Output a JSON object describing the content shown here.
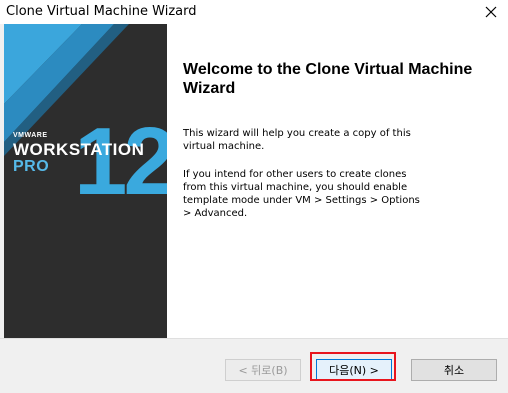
{
  "window": {
    "title": "Clone Virtual Machine Wizard"
  },
  "banner": {
    "vendor": "VMWARE",
    "product": "WORKSTATION",
    "edition": "PRO",
    "version": "12",
    "colors": {
      "background": "#2d2d2d",
      "accent": "#56b9e8"
    }
  },
  "content": {
    "heading": "Welcome to the Clone Virtual Machine Wizard",
    "paragraph1": "This wizard will help you create a copy of this virtual machine.",
    "paragraph2": "If you intend for other users to create clones from this virtual machine, you should enable template mode under VM > Settings > Options > Advanced."
  },
  "buttons": {
    "back_label": "< 뒤로(B)",
    "next_label": "다음(N) >",
    "cancel_label": "취소"
  },
  "icons": {
    "close": "close-icon"
  },
  "colors": {
    "highlight": "#e8151d",
    "focus": "#0078d7"
  }
}
